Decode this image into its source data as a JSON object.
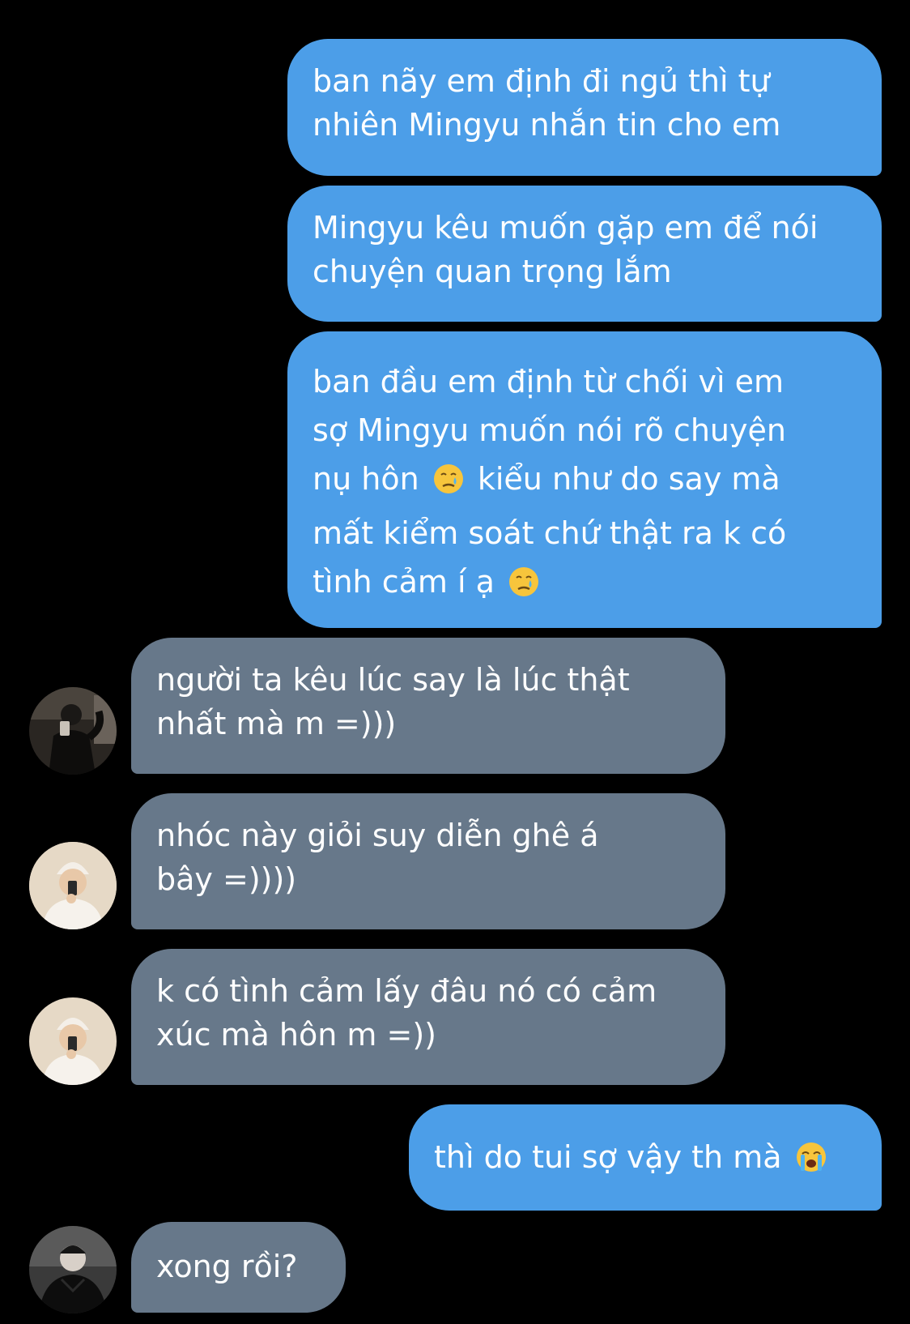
{
  "conversation": {
    "messages": [
      {
        "direction": "sent",
        "lines": [
          "ban nãy em định đi ngủ thì tự",
          "nhiên Mingyu nhắn tin cho em"
        ]
      },
      {
        "direction": "sent",
        "lines": [
          "Mingyu kêu muốn gặp em để nói",
          "chuyện quan trọng lắm"
        ]
      },
      {
        "direction": "sent",
        "lines": [
          "ban đầu em định từ chối vì em",
          "sợ Mingyu muốn nói rõ chuyện",
          "nụ hôn",
          "kiểu như do say mà",
          "mất kiểm soát chứ thật ra k có",
          "tình cảm í ạ"
        ],
        "emoji": "crying-face"
      },
      {
        "direction": "received",
        "avatar": "avatar-dark-jacket-mirror-selfie",
        "lines": [
          "người ta kêu lúc say là lúc thật",
          "nhất mà m =)))"
        ]
      },
      {
        "direction": "received",
        "avatar": "avatar-white-beanie-mirror-selfie",
        "lines": [
          "nhóc này giỏi suy diễn ghê á",
          "bây =))))"
        ]
      },
      {
        "direction": "received",
        "avatar": "avatar-white-beanie-mirror-selfie",
        "lines": [
          "k có tình cảm lấy đâu nó có cảm",
          "xúc mà hôn m =))"
        ]
      },
      {
        "direction": "sent",
        "lines": [
          "thì do tui sợ vậy th mà"
        ],
        "emoji": "loudly-crying-face"
      },
      {
        "direction": "received",
        "avatar": "avatar-black-jacket-portrait",
        "lines": [
          "xong rồi?"
        ]
      }
    ]
  },
  "colors": {
    "background": "#000000",
    "sent_bubble": "#4c9ee8",
    "received_bubble": "#67788a",
    "text": "#ffffff"
  }
}
